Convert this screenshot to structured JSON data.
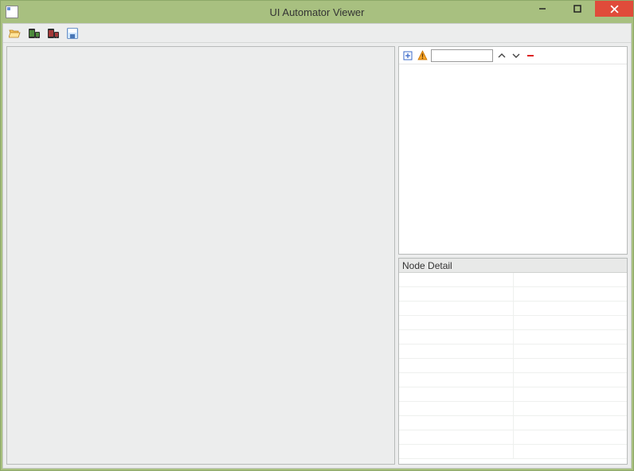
{
  "window": {
    "title": "UI Automator Viewer"
  },
  "toolbar": {
    "open_label": "Open",
    "screenshot_label": "Device Screenshot",
    "screenshot2_label": "Device Screenshot compressed",
    "save_label": "Save"
  },
  "tree": {
    "expand_label": "Expand All",
    "warn_label": "Toggle NAF",
    "search_value": "",
    "prev_label": "Previous",
    "next_label": "Next",
    "clear_label": "Clear"
  },
  "detail": {
    "header": "Node Detail",
    "row_count": 13
  },
  "controls": {
    "minimize": "Minimize",
    "maximize": "Maximize",
    "close": "Close"
  }
}
